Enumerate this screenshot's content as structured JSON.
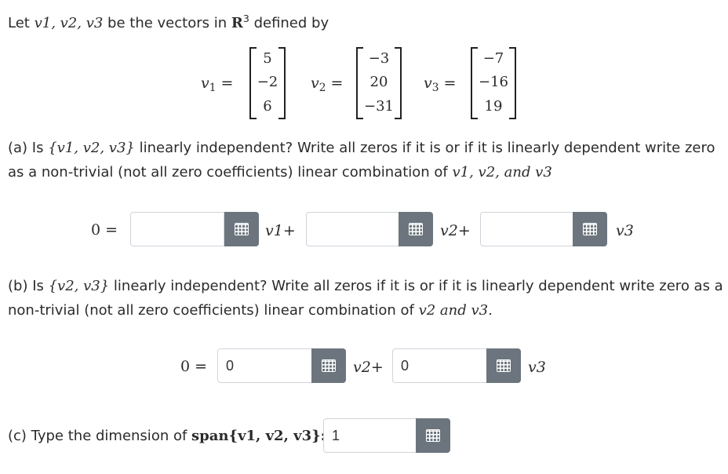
{
  "intro": {
    "prefix": "Let ",
    "vectors_list": "v1, v2, v3",
    "mid": " be the vectors in ",
    "space": "R",
    "exp": "3",
    "suffix": " defined by"
  },
  "vectors": [
    {
      "name": "v",
      "sub": "1",
      "entries": [
        "5",
        "−2",
        "6"
      ]
    },
    {
      "name": "v",
      "sub": "2",
      "entries": [
        "−3",
        "20",
        "−31"
      ]
    },
    {
      "name": "v",
      "sub": "3",
      "entries": [
        "−7",
        "−16",
        "19"
      ]
    }
  ],
  "part_a": {
    "line1_prefix": "(a) Is ",
    "set": "{v1, v2, v3}",
    "line1_suffix": " linearly independent? Write all zeros if it is or if it is linearly dependent write zero",
    "line2": "as a non-trivial (not all zero coefficients) linear combination of ",
    "line2_vars": "v1, v2, and v3",
    "lhs": "0 =",
    "inputs": [
      "",
      "",
      ""
    ],
    "terms": [
      "v1+",
      "v2+",
      "v3"
    ]
  },
  "part_b": {
    "line1_prefix": "(b) Is ",
    "set": "{v2, v3}",
    "line1_suffix": " linearly independent? Write all zeros if it is or if it is linearly dependent write zero as a",
    "line2": "non-trivial (not all zero coefficients) linear combination of ",
    "line2_vars": "v2 and v3.",
    "lhs": "0 =",
    "inputs": [
      "0",
      "0"
    ],
    "terms": [
      "v2+",
      "v3"
    ]
  },
  "part_c": {
    "prefix": "(c) Type the dimension of ",
    "span": "span{v1, v2, v3}:",
    "input": "1"
  }
}
